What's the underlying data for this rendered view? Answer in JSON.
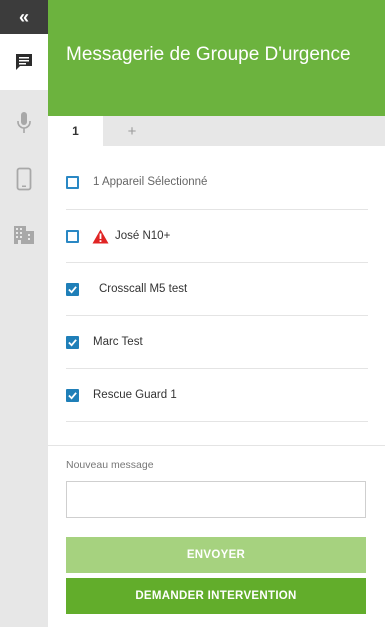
{
  "sidebar": {
    "collapse_glyph": "«",
    "items": [
      {
        "icon": "chat-icon",
        "active": true
      },
      {
        "icon": "microphone-icon",
        "active": false
      },
      {
        "icon": "mobile-device-icon",
        "active": false
      },
      {
        "icon": "building-icon",
        "active": false
      }
    ]
  },
  "header": {
    "title": "Messagerie de Groupe D'urgence"
  },
  "tabs": {
    "active_label": "1",
    "add_label": "+"
  },
  "devices": {
    "summary": "1 Appareil Sélectionné",
    "items": [
      {
        "name": "José N10+",
        "checked": false,
        "warning": true
      },
      {
        "name": "Crosscall M5 test",
        "checked": true,
        "warning": false
      },
      {
        "name": "Marc Test",
        "checked": true,
        "warning": false
      },
      {
        "name": "Rescue Guard 1",
        "checked": true,
        "warning": false
      }
    ]
  },
  "message": {
    "label": "Nouveau message",
    "value": "",
    "placeholder": ""
  },
  "actions": {
    "send_label": "ENVOYER",
    "intervention_label": "DEMANDER INTERVENTION"
  },
  "colors": {
    "brand_green": "#6cb33e",
    "button_green": "#62ad2b",
    "button_disabled": "#a6d27f",
    "checkbox_blue": "#1f7fb8",
    "warning_red": "#e02424"
  }
}
